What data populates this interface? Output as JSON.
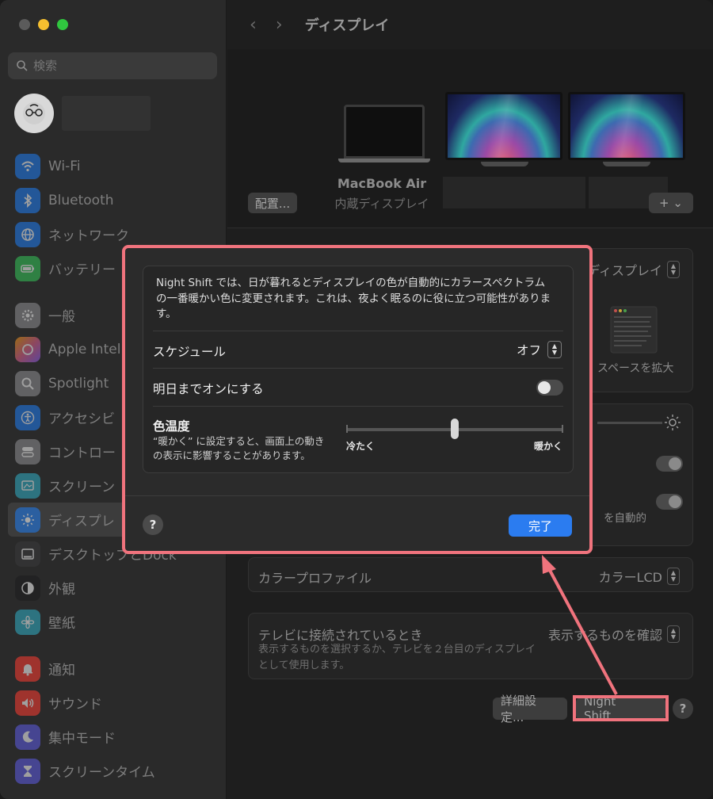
{
  "colors": {
    "accent_blue": "#2b7cf0",
    "annotation": "#f0737d",
    "traffic_min": "#f5bf2f",
    "traffic_max": "#30c63f"
  },
  "sidebar": {
    "search_placeholder": "検索",
    "items": [
      {
        "label": "Wi-Fi",
        "icon": "wifi-icon",
        "color": "#1e7cf2"
      },
      {
        "label": "Bluetooth",
        "icon": "bluetooth-icon",
        "color": "#1e7cf2"
      },
      {
        "label": "ネットワーク",
        "icon": "globe-icon",
        "color": "#1e7cf2"
      },
      {
        "label": "バッテリー",
        "icon": "battery-icon",
        "color": "#34c759"
      },
      {
        "label": "一般",
        "icon": "gear-icon",
        "color": "#8e8e93"
      },
      {
        "label": "Apple Intel",
        "icon": "apple-intelligence-icon",
        "color": "#e0608a"
      },
      {
        "label": "Spotlight",
        "icon": "magnifier-icon",
        "color": "#8e8e93"
      },
      {
        "label": "アクセシビ",
        "icon": "accessibility-icon",
        "color": "#1e7cf2"
      },
      {
        "label": "コントロー",
        "icon": "toggles-icon",
        "color": "#8e8e93"
      },
      {
        "label": "スクリーン",
        "icon": "screensaver-icon",
        "color": "#30b0c7"
      },
      {
        "label": "ディスプレ",
        "icon": "sun-icon",
        "color": "#1e7cf2"
      },
      {
        "label": "デスクトップとDock",
        "icon": "dock-icon",
        "color": "#2c2c2e"
      },
      {
        "label": "外観",
        "icon": "appearance-icon",
        "color": "#2c2c2e"
      },
      {
        "label": "壁紙",
        "icon": "flower-icon",
        "color": "#30b0c7"
      },
      {
        "label": "通知",
        "icon": "bell-icon",
        "color": "#ff3b30"
      },
      {
        "label": "サウンド",
        "icon": "speaker-icon",
        "color": "#ff3b30"
      },
      {
        "label": "集中モード",
        "icon": "moon-icon",
        "color": "#5e5ce6"
      },
      {
        "label": "スクリーンタイム",
        "icon": "hourglass-icon",
        "color": "#5e5ce6"
      }
    ]
  },
  "main": {
    "title": "ディスプレイ",
    "arrange_button": "配置...",
    "laptop_name": "MacBook Air",
    "laptop_sub": "内蔵ディスプレイ",
    "add_button": "+ ⌄",
    "display_popup": "ディスプレイ",
    "enlarge_space": "スペースを拡大",
    "auto_label": "を自動的",
    "color_profile_label": "カラープロファイル",
    "color_profile_value": "カラーLCD",
    "tv_label": "テレビに接続されているとき",
    "tv_value": "表示するものを確認",
    "tv_sub": "表示するものを選択するか、テレビを２台目のディスプレイとして使用します。",
    "advanced_button": "詳細設定...",
    "night_shift_button": "Night Shift...",
    "help": "?"
  },
  "dialog": {
    "description": "Night Shift では、日が暮れるとディスプレイの色が自動的にカラースペクトラムの一番暖かい色に変更されます。これは、夜よく眠るのに役に立つ可能性があります。",
    "schedule_label": "スケジュール",
    "schedule_value": "オフ",
    "tomorrow_label": "明日までオンにする",
    "tomorrow_on": false,
    "temp_label": "色温度",
    "temp_sub": "“暖かく” に設定すると、画面上の動きの表示に影響することがあります。",
    "temp_min": "冷たく",
    "temp_max": "暖かく",
    "temp_level": 0.5,
    "help": "?",
    "done": "完了"
  }
}
